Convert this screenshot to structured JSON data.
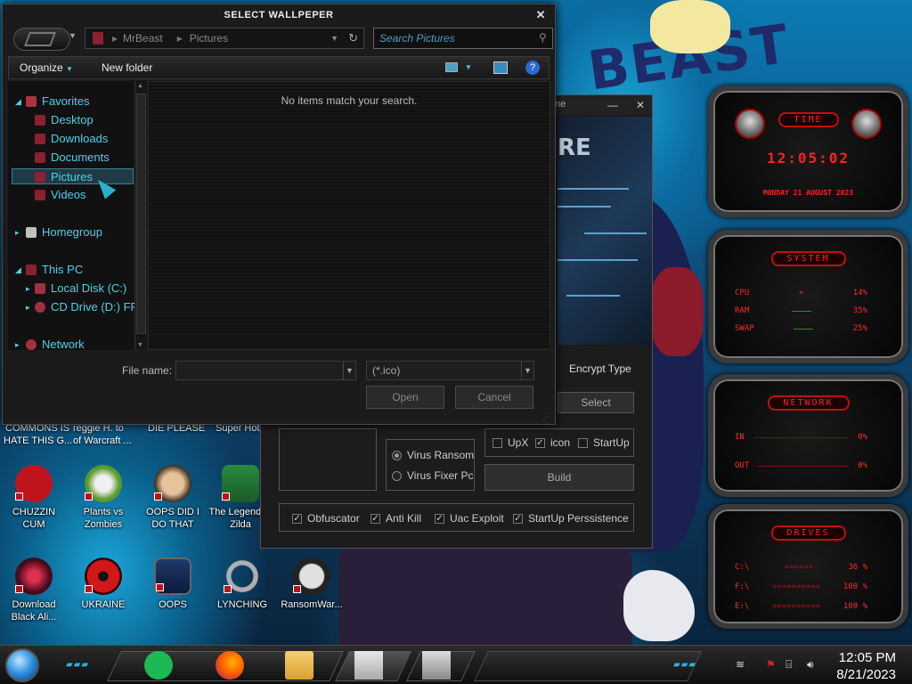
{
  "dialog": {
    "title": "SELECT WALLPEPER",
    "close": "✕",
    "address": {
      "segment1": "MrBeast",
      "separator": "▸",
      "segment2": "Pictures"
    },
    "search_placeholder": "Search Pictures",
    "toolbar": {
      "organize": "Organize",
      "new_folder": "New folder"
    },
    "nav": {
      "favorites": "Favorites",
      "desktop": "Desktop",
      "downloads": "Downloads",
      "documents": "Documents",
      "pictures": "Pictures",
      "videos": "Videos",
      "homegroup": "Homegroup",
      "this_pc": "This PC",
      "local_disk": "Local Disk (C:)",
      "cd_drive": "CD Drive (D:) FF",
      "network": "Network"
    },
    "empty_message": "No items match your search.",
    "file_name_label": "File name:",
    "file_name_value": "",
    "filter_value": "(*.ico)",
    "open": "Open",
    "cancel": "Cancel"
  },
  "builder": {
    "title_partial": "ne",
    "minimize": "—",
    "close": "✕",
    "logo": "RE",
    "encrypt_type": "Encrypt Type",
    "select": "Select",
    "virus_ransom": "Virus Ransom",
    "virus_fixer": "Virus Fixer Pc",
    "upx": "UpX",
    "icon": "icon",
    "startup": "StartUp",
    "build": "Build",
    "obfuscator": "Obfuscator",
    "anti_kill": "Anti Kill",
    "uac_exploit": "Uac Exploit",
    "startup_persistence": "StartUp Perssistence",
    "checkmark": "✓"
  },
  "desktop_icons": [
    {
      "label": "CHUZZIN CUM",
      "color": "#c0141c"
    },
    {
      "label": "Plants vs Zombies",
      "color": "#5a9a2a"
    },
    {
      "label": "OOPS DID I DO THAT",
      "color": "#caa070"
    },
    {
      "label": "The Legend of Zilda",
      "color": "#2a8a3a"
    },
    {
      "label": "Download Black Ali...",
      "color": "#6a1a2a"
    },
    {
      "label": "UKRAINE",
      "color": "#c01818"
    },
    {
      "label": "OOPS",
      "color": "#203a6a"
    },
    {
      "label": "LYNCHING",
      "color": "#b0b0b0"
    },
    {
      "label": "RansomWar...",
      "color": "#e0e0e0"
    }
  ],
  "desktop_partial_labels": {
    "row1": "COMMONS IS",
    "row1b": "HATE THIS G...",
    "col2a": "reggie H. to",
    "col2b": "of Warcraft ...",
    "col3": "DIE PLEASE",
    "col4": "Super Hot"
  },
  "gadgets": {
    "time": {
      "caption": "TIME",
      "clock": "12:05:02",
      "date": "MONDAY 21 AUGUST 2023"
    },
    "system": {
      "caption": "SYSTEM",
      "rows": [
        {
          "name": "CPU",
          "value": "14%"
        },
        {
          "name": "RAM",
          "value": "35%"
        },
        {
          "name": "SWAP",
          "value": "25%"
        }
      ]
    },
    "network": {
      "caption": "NETWORK",
      "rows": [
        {
          "name": "IN",
          "value": "0%"
        },
        {
          "name": "OUT",
          "value": "0%"
        }
      ]
    },
    "drives": {
      "caption": "DRIVES",
      "rows": [
        {
          "name": "C:\\",
          "value": "36 %"
        },
        {
          "name": "F:\\",
          "value": "100 %"
        },
        {
          "name": "E:\\",
          "value": "100 %"
        }
      ]
    }
  },
  "taskbar": {
    "time": "12:05 PM",
    "date": "8/21/2023",
    "dashes": "▰▰▰"
  },
  "wallpaper_text": "BEAST"
}
